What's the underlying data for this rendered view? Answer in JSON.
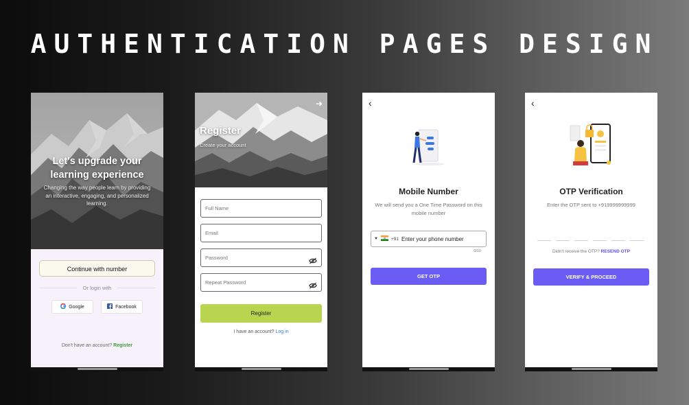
{
  "headline": "AUTHENTICATION PAGES DESIGN",
  "colors": {
    "accent_green": "#b9d44f",
    "accent_purple": "#6b5cf3",
    "link_blue": "#2f7fe0",
    "register_green": "#3c9a3a"
  },
  "screen1": {
    "title": "Let's upgrade your learning experience",
    "subtitle": "Changing the way people learn by providing an interactive, engaging, and personalized learning.",
    "continue_label": "Continue with number",
    "or_label": "Or login with",
    "google_label": "Google",
    "facebook_label": "Facebook",
    "no_account_text": "Don't have an account?",
    "register_link": "Register"
  },
  "screen2": {
    "title": "Register",
    "subtitle": "Create your account",
    "fields": {
      "full_name": "Full Name",
      "email": "Email",
      "password": "Password",
      "repeat_password": "Repeat Password"
    },
    "register_button": "Register",
    "have_account_text": "I have an account?",
    "login_link": "Log in"
  },
  "screen3": {
    "title": "Mobile Number",
    "description": "We will send you a One Time Password on this mobile number",
    "country_code": "+91",
    "phone_placeholder": "Enter your phone number",
    "counter": "0/10",
    "button": "GET OTP"
  },
  "screen4": {
    "title": "OTP Verification",
    "description": "Enter the OTP sent to +919999999999",
    "otp_slots": 6,
    "resend_prompt": "Didn't receive the OTP?",
    "resend_link": "RESEND OTP",
    "button": "VERIFY & PROCEED"
  }
}
